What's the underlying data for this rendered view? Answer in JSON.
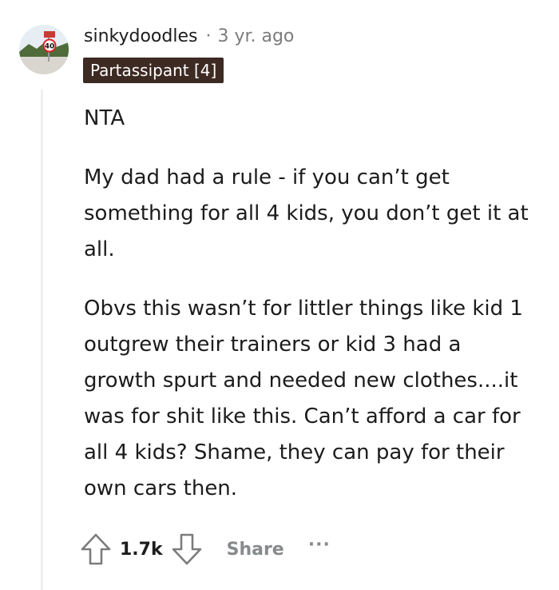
{
  "comment": {
    "author": "sinkydoodles",
    "separator": "·",
    "timestamp": "3 yr. ago",
    "flair": "Partassipant [4]",
    "paragraphs": [
      "NTA",
      "My dad had a rule - if you can’t get something for all 4 kids, you don’t get it at all.",
      "Obvs this wasn’t for littler things like kid 1 outgrew their trainers or kid 3 had a growth spurt and needed new clothes....it was for shit like this. Can’t afford a car for all 4 kids? Shame, they can pay for their own cars then."
    ],
    "avatar_sign_text": "40"
  },
  "actions": {
    "upvote_icon": "upvote-arrow-icon",
    "score": "1.7k",
    "downvote_icon": "downvote-arrow-icon",
    "share_label": "Share",
    "more_label": "···"
  },
  "colors": {
    "flair_bg": "#3d2a22",
    "muted_text": "#7c7c7c",
    "action_gray": "#878a8c",
    "thread_line": "#edeff1"
  }
}
